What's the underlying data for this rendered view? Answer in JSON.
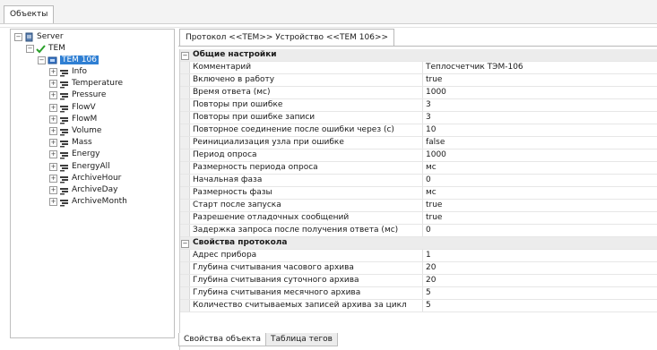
{
  "window": {
    "tab_label": "Объекты"
  },
  "tree": {
    "server": "Server",
    "tem": "TEM",
    "device": "TEM 106",
    "children": [
      "Info",
      "Temperature",
      "Pressure",
      "FlowV",
      "FlowM",
      "Volume",
      "Mass",
      "Energy",
      "EnergyAll",
      "ArchiveHour",
      "ArchiveDay",
      "ArchiveMonth"
    ]
  },
  "panel": {
    "tab_title": "Протокол <<TEM>> Устройство <<TEM 106>>",
    "sections": [
      {
        "title": "Общие настройки",
        "rows": [
          {
            "name": "Комментарий",
            "value": "Теплосчетчик ТЭМ-106"
          },
          {
            "name": "Включено в работу",
            "value": "true"
          },
          {
            "name": "Время ответа (мс)",
            "value": "1000"
          },
          {
            "name": "Повторы при ошибке",
            "value": "3"
          },
          {
            "name": "Повторы при ошибке записи",
            "value": "3"
          },
          {
            "name": "Повторное соединение после ошибки через (с)",
            "value": "10"
          },
          {
            "name": "Реинициализация узла при ошибке",
            "value": "false"
          },
          {
            "name": "Период опроса",
            "value": "1000"
          },
          {
            "name": "Размерность периода опроса",
            "value": "мс"
          },
          {
            "name": "Начальная фаза",
            "value": "0"
          },
          {
            "name": "Размерность фазы",
            "value": "мс"
          },
          {
            "name": "Старт после запуска",
            "value": "true"
          },
          {
            "name": "Разрешение отладочных сообщений",
            "value": "true"
          },
          {
            "name": "Задержка запроса после получения ответа (мс)",
            "value": "0"
          }
        ]
      },
      {
        "title": "Свойства протокола",
        "rows": [
          {
            "name": "Адрес прибора",
            "value": "1"
          },
          {
            "name": "Глубина считывания часового архива",
            "value": "20"
          },
          {
            "name": "Глубина считывания суточного архива",
            "value": "20"
          },
          {
            "name": "Глубина считывания месячного архива",
            "value": "5"
          },
          {
            "name": "Количество считываемых записей архива за цикл",
            "value": "5"
          }
        ]
      }
    ]
  },
  "bottom_tabs": [
    "Свойства объекта",
    "Таблица тегов"
  ],
  "colors": {
    "selection": "#2f7fd3",
    "category_bg": "#ececec",
    "server_icon": "#3a6ea5",
    "tem_icon": "#2aa02a",
    "tag_icon": "#3c3c3c"
  },
  "icons": {
    "server": "server-icon",
    "protocol": "protocol-icon",
    "device": "device-icon",
    "tag": "tag-icon"
  }
}
